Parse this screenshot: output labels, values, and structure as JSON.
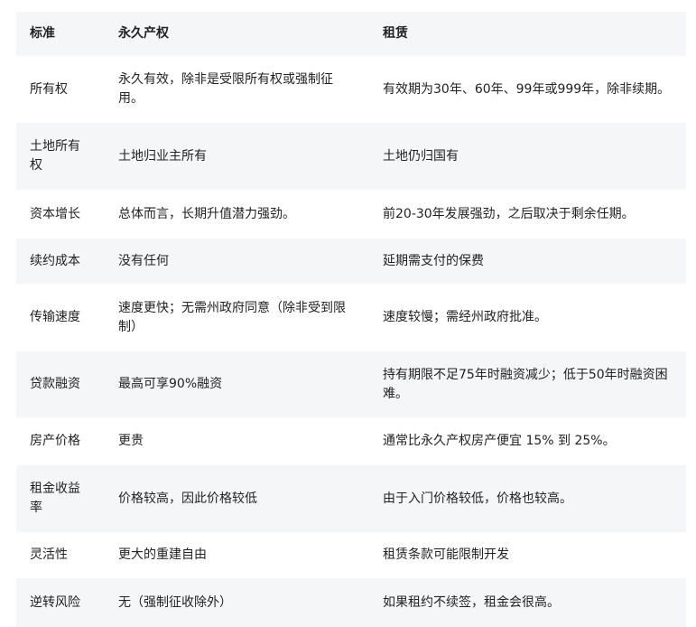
{
  "table": {
    "headers": [
      "标准",
      "永久产权",
      "租赁"
    ],
    "rows": [
      [
        "所有权",
        "永久有效，除非是受限所有权或强制征用。",
        "有效期为30年、60年、99年或999年，除非续期。"
      ],
      [
        "土地所有权",
        "土地归业主所有",
        "土地仍归国有"
      ],
      [
        "资本增长",
        "总体而言，长期升值潜力强劲。",
        "前20-30年发展强劲，之后取决于剩余任期。"
      ],
      [
        "续约成本",
        "没有任何",
        "延期需支付的保费"
      ],
      [
        "传输速度",
        "速度更快；无需州政府同意（除非受到限制）",
        "速度较慢；需经州政府批准。"
      ],
      [
        "贷款融资",
        "最高可享90%融资",
        "持有期限不足75年时融资减少；低于50年时融资困难。"
      ],
      [
        "房产价格",
        "更贵",
        "通常比永久产权房产便宜 15% 到 25%。"
      ],
      [
        "租金收益率",
        "价格较高，因此价格较低",
        "由于入门价格较低，价格也较高。"
      ],
      [
        "灵活性",
        "更大的重建自由",
        "租赁条款可能限制开发"
      ],
      [
        "逆转风险",
        "无（强制征收除外）",
        "如果租约不续签，租金会很高。"
      ]
    ]
  }
}
